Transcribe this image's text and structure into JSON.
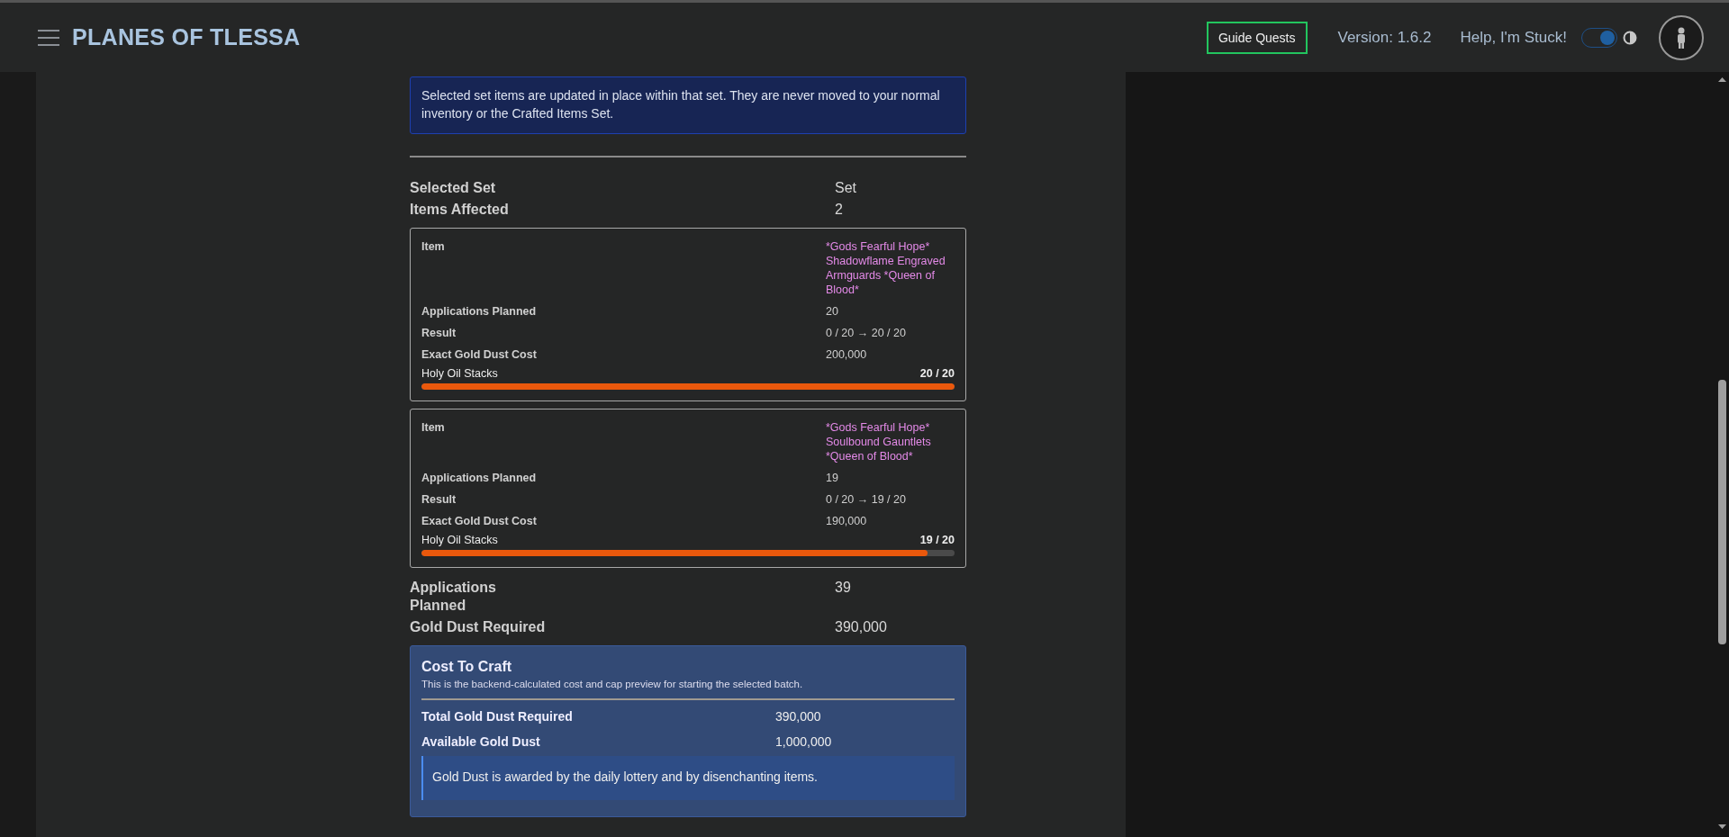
{
  "header": {
    "title": "PLANES OF TLESSA",
    "guide_button": "Guide Quests",
    "version": "Version: 1.6.2",
    "help_link": "Help, I'm Stuck!",
    "theme_toggle": {
      "on": true
    }
  },
  "notice": "Selected set items are updated in place within that set. They are never moved to your normal inventory or the Crafted Items Set.",
  "summary": [
    {
      "label": "Selected Set",
      "value": "Set"
    },
    {
      "label": "Items Affected",
      "value": "2"
    }
  ],
  "items": [
    {
      "rows": [
        {
          "label": "Item",
          "value": "*Gods Fearful Hope* Shadowflame Engraved Armguards *Queen of Blood*",
          "kind": "name"
        },
        {
          "label": "Applications Planned",
          "value": "20",
          "kind": "plain"
        },
        {
          "label": "Result",
          "value": "0 / 20 → 20 / 20",
          "kind": "plain"
        },
        {
          "label": "Exact Gold Dust Cost",
          "value": "200,000",
          "kind": "plain"
        }
      ],
      "meter": {
        "label": "Holy Oil Stacks",
        "reading": "20 / 20",
        "level": 1.0
      }
    },
    {
      "rows": [
        {
          "label": "Item",
          "value": "*Gods Fearful Hope* Soulbound Gauntlets *Queen of Blood*",
          "kind": "name"
        },
        {
          "label": "Applications Planned",
          "value": "19",
          "kind": "plain"
        },
        {
          "label": "Result",
          "value": "0 / 20 → 19 / 20",
          "kind": "plain"
        },
        {
          "label": "Exact Gold Dust Cost",
          "value": "190,000",
          "kind": "plain"
        }
      ],
      "meter": {
        "label": "Holy Oil Stacks",
        "reading": "19 / 20",
        "level": 0.95
      }
    }
  ],
  "totals": [
    {
      "label": "Applications Planned",
      "value": "39"
    },
    {
      "label": "Gold Dust Required",
      "value": "390,000"
    }
  ],
  "cost_panel": {
    "title": "Cost To Craft",
    "subtitle": "This is the backend-calculated cost and cap preview for starting the selected batch.",
    "rows": [
      {
        "label": "Total Gold Dust Required",
        "value": "390,000"
      },
      {
        "label": "Available Gold Dust",
        "value": "1,000,000"
      }
    ],
    "note": "Gold Dust is awarded by the daily lottery and by disenchanting items."
  }
}
